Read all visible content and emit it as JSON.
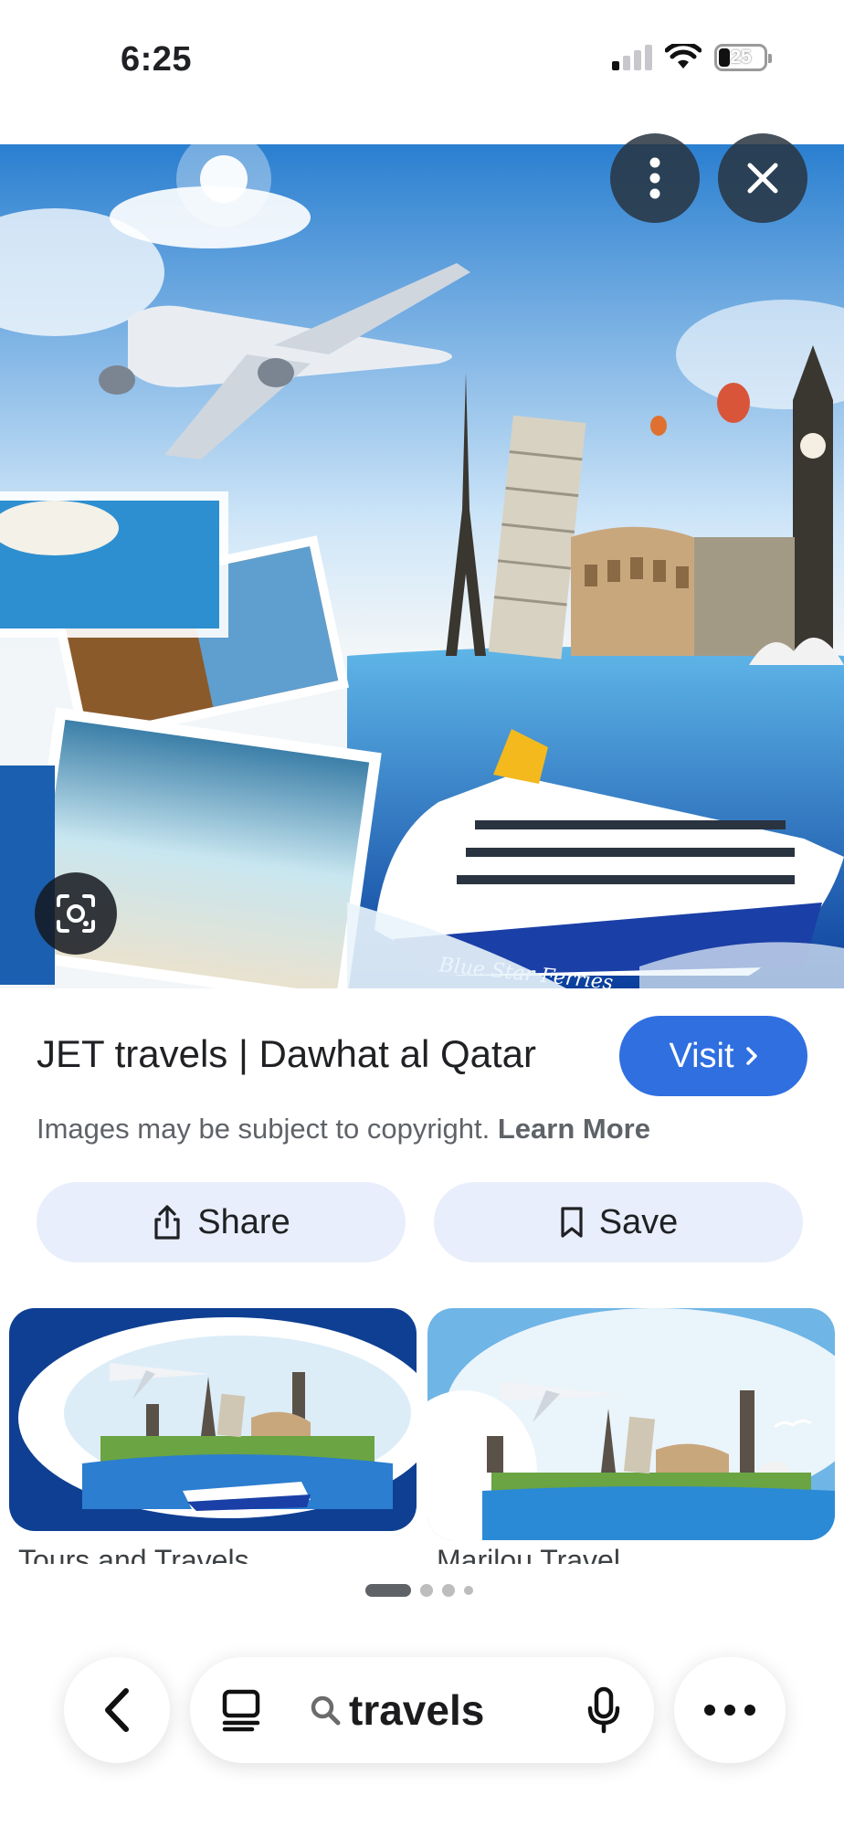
{
  "status_bar": {
    "time": "6:25",
    "battery_level": "25",
    "signal_bars_on": 1,
    "icons": [
      "cellular-signal-icon",
      "wifi-icon",
      "battery-icon"
    ]
  },
  "hero": {
    "overlay_buttons": [
      "more-vertical-icon",
      "close-icon"
    ],
    "ferry_text": "Blue Star Ferries",
    "lens_icon": "visual-search-icon"
  },
  "result": {
    "title": "JET travels | Dawhat al Qatar",
    "visit_label": "Visit",
    "copyright_text": "Images may be subject to copyright.",
    "learn_more": "Learn More"
  },
  "actions": {
    "share_label": "Share",
    "save_label": "Save"
  },
  "related": [
    {
      "label": "Tours and Travels"
    },
    {
      "label": "Marilou Travel"
    }
  ],
  "pager": {
    "active_index": 0,
    "count": 4
  },
  "toolbar": {
    "query": "travels",
    "icons": [
      "back-chevron-icon",
      "tabs-icon",
      "search-icon",
      "microphone-icon",
      "more-horizontal-icon"
    ]
  },
  "colors": {
    "accent": "#2f6fe0",
    "button_tint": "#e8eefb",
    "ocean": "#1f5fb8",
    "sky": "#d8ecfb"
  }
}
